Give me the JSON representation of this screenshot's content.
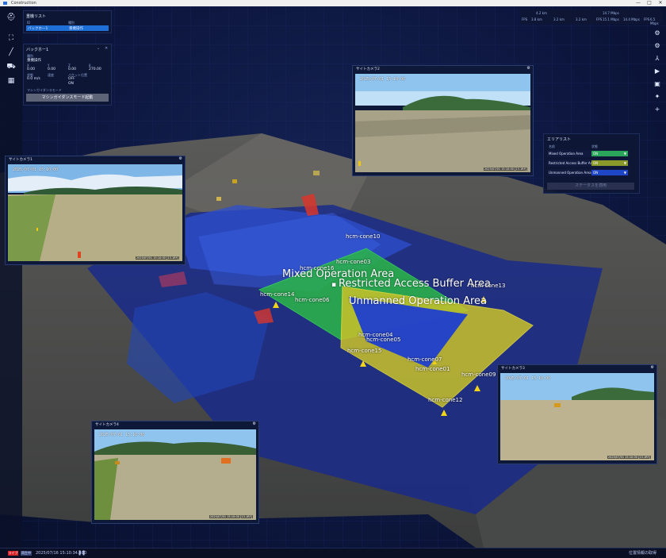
{
  "window": {
    "title": "Construction",
    "controls": [
      "—",
      "□",
      "✕"
    ]
  },
  "left_toolbar": {
    "icons": [
      "person-badge-icon",
      "crop-area-icon",
      "ruler-line-icon",
      "excavator-icon",
      "calendar-icon"
    ]
  },
  "right_toolbar": {
    "icons": [
      "gear-icon",
      "settings-alt-icon",
      "axis-icon",
      "video-camera-icon",
      "image-icon",
      "crosshair-icon",
      "zoom-in-icon"
    ]
  },
  "machine_list": {
    "title": "重機リスト",
    "col1_header": "ID",
    "col2_header": "種別",
    "selected_id": "バックホー1",
    "selected_type": "重機操作"
  },
  "machine_detail": {
    "title": "バックホー1",
    "section_label": "種別",
    "section_value": "重機操作",
    "row1_labels": [
      "X",
      "Y",
      "Z",
      "θ"
    ],
    "row1_values": [
      "0.00",
      "0.00",
      "0.00",
      "270.00"
    ],
    "row2_labels": [
      "状態",
      "速度",
      "バケット位置"
    ],
    "row2_values": [
      "0.0 m/s",
      "OFF",
      "ON"
    ],
    "note": "マシンガイダンスモード",
    "button": "マシンガイダンスモード起動"
  },
  "stats": {
    "headers": [
      "",
      "4.2 km",
      "",
      "14.7 Mbps"
    ],
    "labels": [
      "FPS",
      "3.2 km",
      "3.2 km",
      "FPS",
      "15.1 Mbps",
      "14.4 Mbps",
      "FPS"
    ],
    "values": [
      "3.8 km",
      "6.5 Mbps"
    ]
  },
  "area_list": {
    "title": "エリアリスト",
    "col_name": "名前",
    "col_status": "状態",
    "rows": [
      {
        "name": "Mixed Operation Area",
        "status": "ON",
        "color": "#2aa55a"
      },
      {
        "name": "Restricted Access Buffer Area",
        "status": "ON",
        "color": "#8a9a2a"
      },
      {
        "name": "Unmanned Operation Area",
        "status": "ON",
        "color": "#2046c8"
      }
    ],
    "apply_button": "ステータスを適用"
  },
  "cameras": [
    {
      "title": "サイトカメラ1",
      "stamp": "2025/07/01 15:10:00",
      "foot": "2025/07/01 15:10:00 [13.1RF]"
    },
    {
      "title": "サイトカメラ2",
      "stamp": "2025/07/01 15:10:00",
      "foot": "2025/07/01 15:10:00 [13.1RF]"
    },
    {
      "title": "サイトカメラ3",
      "stamp": "2025/07/01 15:10:00",
      "foot": "2025/07/01 15:10:00 [13.1RF]"
    },
    {
      "title": "サイトカメラ4",
      "stamp": "2025/07/01 15:10:00",
      "foot": "2025/07/01 15:10:00 [13.1RF]"
    }
  ],
  "areas": {
    "mixed": "Mixed Operation Area",
    "restricted": "Restricted Access Buffer Area",
    "unmanned": "Unmanned Operation Area"
  },
  "cones": {
    "c10": "hcm-cone10",
    "c03": "hcm-cone03",
    "c16": "hcm-cone16",
    "c14": "hcm-cone14",
    "c06": "hcm-cone06",
    "c13": "hcm-cone13",
    "c04": "hcm-cone04",
    "c05": "hcm-cone05",
    "c15": "hcm-cone15",
    "c07": "hcm-cone07",
    "c01": "hcm-cone01",
    "c09": "hcm-cone09",
    "c12": "hcm-cone12"
  },
  "statusbar": {
    "live": "ライブ",
    "mode": "再生中",
    "timestamp": "2025/07/16 15:10:34.480",
    "pause": "❚❚",
    "right": "位置情報の取得"
  },
  "colors": {
    "mixed": "#2bb34a",
    "restricted": "#c9c22a",
    "unmanned": "#1f3fcf",
    "accent": "#1e6fd6"
  }
}
